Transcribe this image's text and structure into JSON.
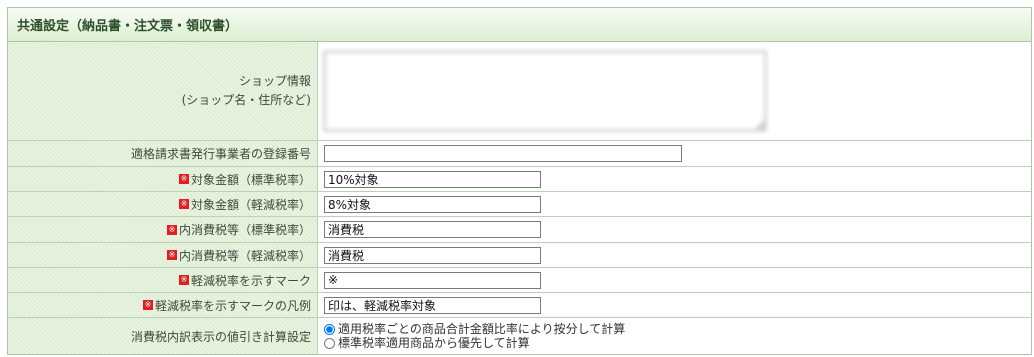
{
  "panel": {
    "title": "共通設定（納品書・注文票・領収書）"
  },
  "rows": {
    "shop_info": {
      "label_line1": "ショップ情報",
      "label_line2": "(ショップ名・住所など)",
      "value": ""
    },
    "registration_number": {
      "label": "適格請求書発行事業者の登録番号",
      "value": ""
    },
    "target_amount_standard": {
      "label": "対象金額（標準税率）",
      "value": "10%対象"
    },
    "target_amount_reduced": {
      "label": "対象金額（軽減税率）",
      "value": "8%対象"
    },
    "consumption_tax_standard": {
      "label": "内消費税等（標準税率）",
      "value": "消費税"
    },
    "consumption_tax_reduced": {
      "label": "内消費税等（軽減税率）",
      "value": "消費税"
    },
    "reduced_rate_mark": {
      "label": "軽減税率を示すマーク",
      "value": "※"
    },
    "reduced_rate_legend": {
      "label": "軽減税率を示すマークの凡例",
      "value": "印は、軽減税率対象"
    },
    "discount_calc": {
      "label": "消費税内訳表示の値引き計算設定",
      "option1": "適用税率ごとの商品合計金額比率により按分して計算",
      "option2": "標準税率適用商品から優先して計算",
      "selected": "option1"
    }
  },
  "required_mark": "※",
  "colors": {
    "header_text": "#2f4f2a",
    "border": "#a9c9a4",
    "required": "#e02020"
  }
}
